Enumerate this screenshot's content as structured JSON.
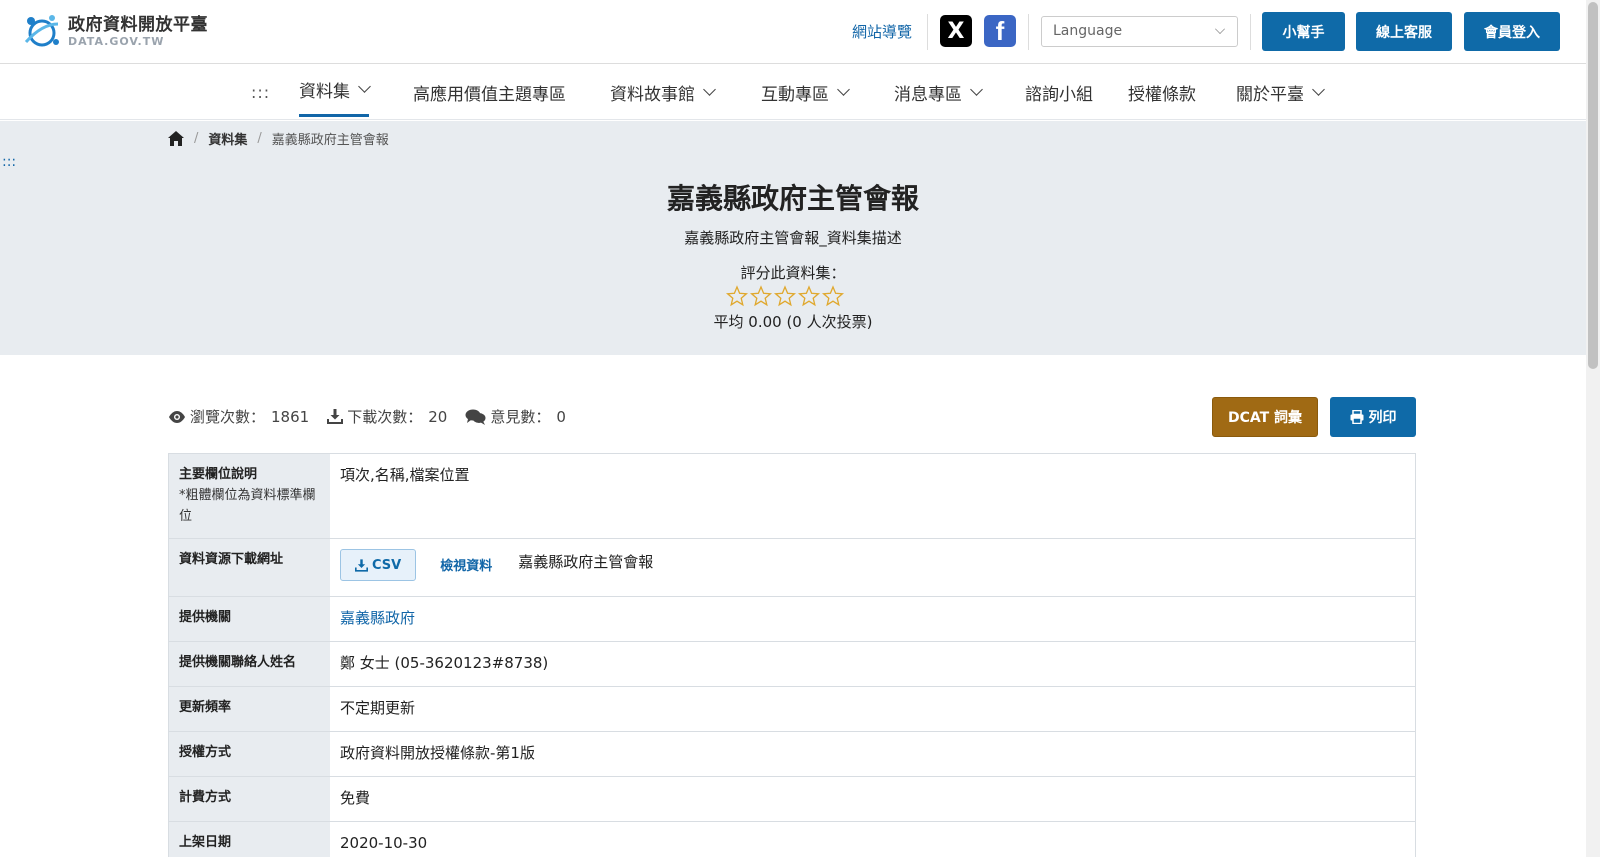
{
  "header": {
    "logo_cn": "政府資料開放平臺",
    "logo_en": "DATA.GOV.TW",
    "sitemap": "網站導覽",
    "sns_x": "X",
    "sns_fb": "f",
    "language_placeholder": "Language",
    "helper_button": "小幫手",
    "service_button": "線上客服",
    "login_button": "會員登入"
  },
  "nav": {
    "dots": ":::",
    "items": [
      {
        "label": "資料集"
      },
      {
        "label": "高應用價值主題專區"
      },
      {
        "label": "資料故事館"
      },
      {
        "label": "互動專區"
      },
      {
        "label": "消息專區"
      },
      {
        "label": "諮詢小組"
      },
      {
        "label": "授權條款"
      },
      {
        "label": "關於平臺"
      }
    ]
  },
  "breadcrumb": {
    "sep": "/",
    "datasets": "資料集",
    "current": "嘉義縣政府主管會報"
  },
  "skip_dots": ":::",
  "dataset": {
    "title": "嘉義縣政府主管會報",
    "description": "嘉義縣政府主管會報_資料集描述",
    "rate_label": "評分此資料集：",
    "rating_stars_filled": 0,
    "rating_stars_total": 5,
    "average": "平均 0.00 (0 人次投票)"
  },
  "stats": {
    "views_label": "瀏覽次數：",
    "views": "1861",
    "downloads_label": "下載次數：",
    "downloads": "20",
    "comments_label": "意見數：",
    "comments": "0"
  },
  "actions": {
    "dcat": "DCAT 詞彙",
    "print": "列印"
  },
  "table": {
    "fields_label": "主要欄位說明",
    "fields_note": "*粗體欄位為資料標準欄位",
    "fields_value": "項次,名稱,檔案位置",
    "resource_label": "資料資源下載網址",
    "csv_button": "CSV",
    "view_link": "檢視資料",
    "resource_name": "嘉義縣政府主管會報",
    "provider_label": "提供機關",
    "provider_value": "嘉義縣政府",
    "contact_label": "提供機關聯絡人姓名",
    "contact_value": "鄭 女士 (05-3620123#8738)",
    "frequency_label": "更新頻率",
    "frequency_value": "不定期更新",
    "license_label": "授權方式",
    "license_value": "政府資料開放授權條款-第1版",
    "fee_label": "計費方式",
    "fee_value": "免費",
    "published_label": "上架日期",
    "published_value": "2020-10-30"
  },
  "colors": {
    "primary": "#0f6aa8",
    "dcat": "#a06a14",
    "hero_bg": "#e8ecf0",
    "star": "#e0a82e"
  }
}
